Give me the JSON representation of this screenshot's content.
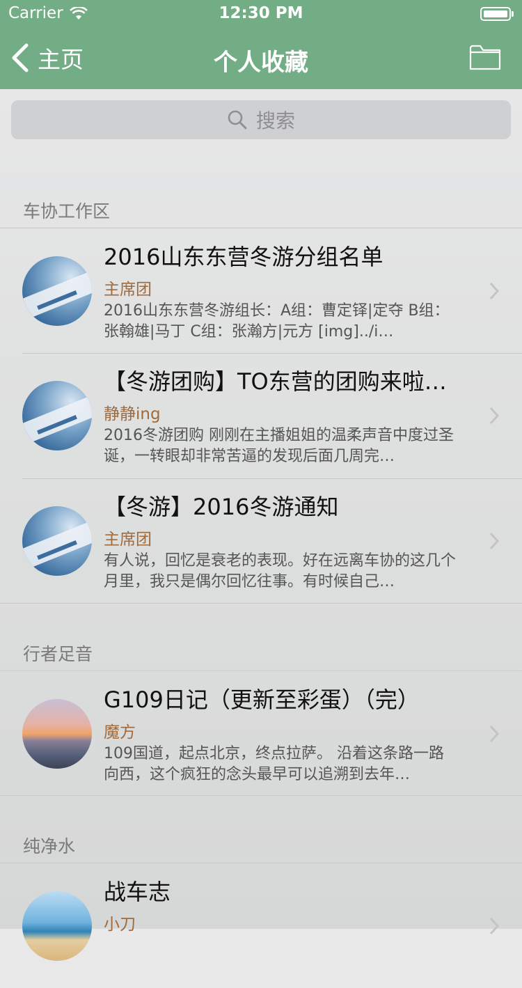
{
  "status_bar": {
    "carrier": "Carrier",
    "time": "12:30 PM"
  },
  "nav": {
    "back_label": "主页",
    "title": "个人收藏"
  },
  "search": {
    "placeholder": "搜索"
  },
  "sections": [
    {
      "header": "车协工作区",
      "items": [
        {
          "title": "2016山东东营冬游分组名单",
          "author": "主席团",
          "preview": "2016山东东营冬游组长：A组：曹定铎|定夺 B组：张翰雄|马丁 C组：张瀚方|元方 [img]../i…"
        },
        {
          "title": "【冬游团购】TO东营的团购来啦…",
          "author": "静静ing",
          "preview": "2016冬游团购 刚刚在主播姐姐的温柔声音中度过圣诞，一转眼却非常苦逼的发现后面几周完…"
        },
        {
          "title": "【冬游】2016冬游通知",
          "author": "主席团",
          "preview": "有人说，回忆是衰老的表现。好在远离车协的这几个月里，我只是偶尔回忆往事。有时候自己…"
        }
      ]
    },
    {
      "header": "行者足音",
      "items": [
        {
          "title": "G109日记（更新至彩蛋）（完）",
          "author": "魔方",
          "preview": "109国道，起点北京，终点拉萨。 沿着这条路一路向西，这个疯狂的念头最早可以追溯到去年…"
        }
      ]
    },
    {
      "header": "纯净水",
      "items": [
        {
          "title": "战车志",
          "author": "小刀",
          "preview": ""
        }
      ]
    }
  ],
  "colors": {
    "nav_bar": "#72ad85",
    "author": "#a06a3a"
  },
  "icons": [
    "wifi-icon",
    "battery-icon",
    "back-chevron-icon",
    "folder-icon",
    "search-icon",
    "chevron-right-icon"
  ]
}
